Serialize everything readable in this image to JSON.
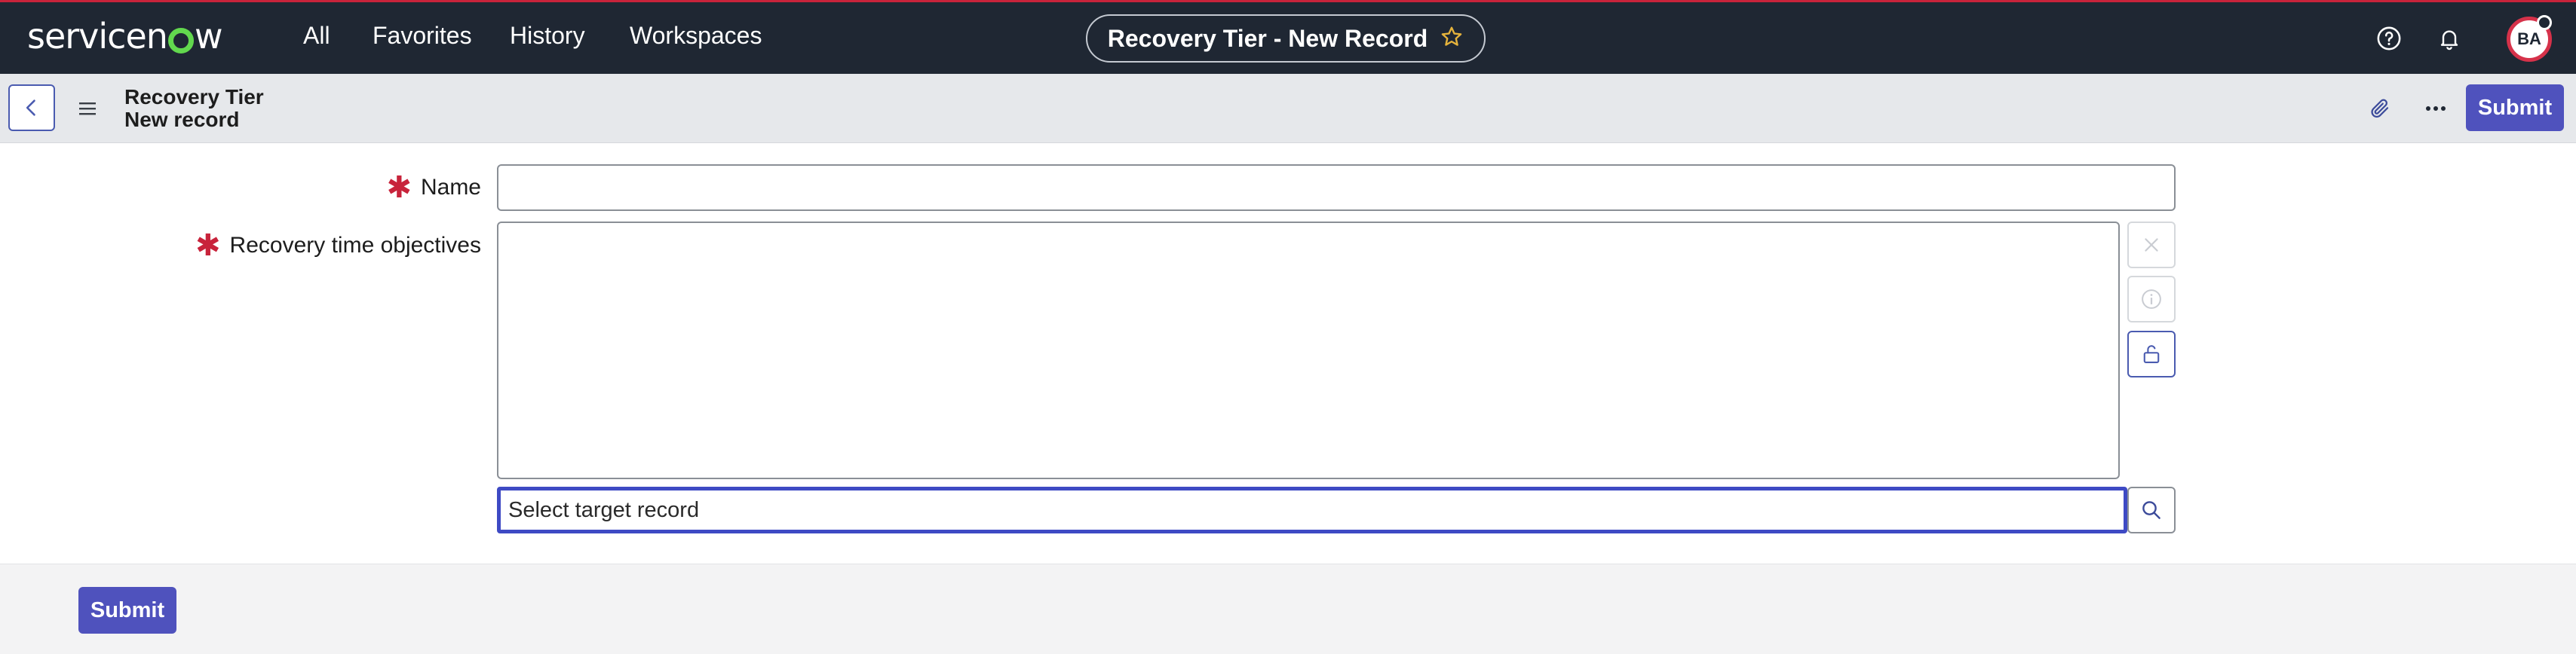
{
  "app": {
    "logo_text_a": "servicen",
    "logo_text_b": "w",
    "nav": [
      "All",
      "Favorites",
      "History",
      "Workspaces"
    ],
    "page_title": "Recovery Tier - New Record",
    "favorite_icon": "star-outline-icon",
    "user_initials": "BA",
    "brand_color": "#62d84e",
    "header_color": "#1f2733",
    "accent_color": "#4f52bd"
  },
  "form_header": {
    "table_name": "Recovery Tier",
    "record_state": "New record",
    "submit_label": "Submit"
  },
  "form": {
    "name_label": "Name",
    "name_value": "",
    "rto_label": "Recovery time objectives",
    "rto_value": "",
    "reference_placeholder": "Select target record",
    "required_marker": "✱"
  },
  "footer": {
    "submit_label": "Submit"
  }
}
